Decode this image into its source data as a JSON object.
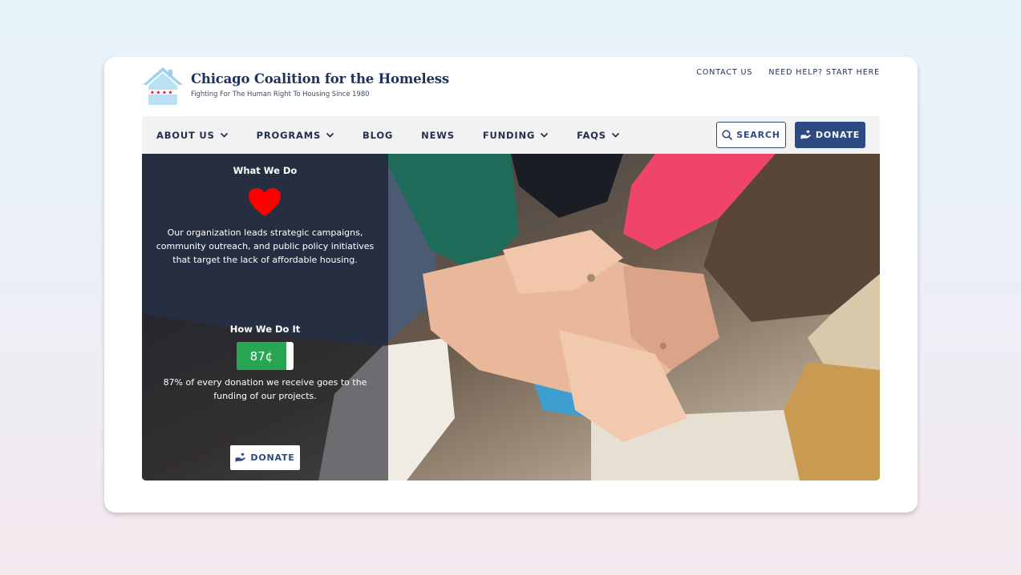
{
  "brand": {
    "name": "Chicago Coalition for the Homeless",
    "tagline": "Fighting For The Human Right To Housing Since 1980"
  },
  "top_links": [
    "CONTACT US",
    "NEED HELP? START HERE"
  ],
  "nav": {
    "items": [
      {
        "label": "ABOUT US",
        "dropdown": true
      },
      {
        "label": "PROGRAMS",
        "dropdown": true
      },
      {
        "label": "BLOG",
        "dropdown": false
      },
      {
        "label": "NEWS",
        "dropdown": false
      },
      {
        "label": "FUNDING",
        "dropdown": true
      },
      {
        "label": "FAQS",
        "dropdown": true
      }
    ],
    "search_label": "SEARCH",
    "donate_label": "DONATE"
  },
  "hero": {
    "what_we_do_heading": "What We Do",
    "what_we_do_body": "Our organization leads strategic campaigns, community outreach, and public policy initiatives that target the lack of affordable housing.",
    "how_we_do_it_heading": "How We Do It",
    "cents_label": "87¢",
    "cents_fraction": 0.87,
    "how_we_do_it_body": "87% of every donation we receive goes to the funding of our projects.",
    "donate_label": "DONATE"
  },
  "icons": {
    "logo": "house-with-chicago-flag-stars-icon",
    "heart": "heart-icon",
    "search": "search-icon",
    "donate": "hand-heart-icon",
    "dropdown": "chevron-down-icon"
  },
  "colors": {
    "brand_navy": "#1d3460",
    "button_blue": "#2e4a83",
    "heart_red": "#ff0000",
    "badge_green": "#27a552",
    "logo_light_blue": "#b3dcf2",
    "star_red": "#e4002b"
  }
}
